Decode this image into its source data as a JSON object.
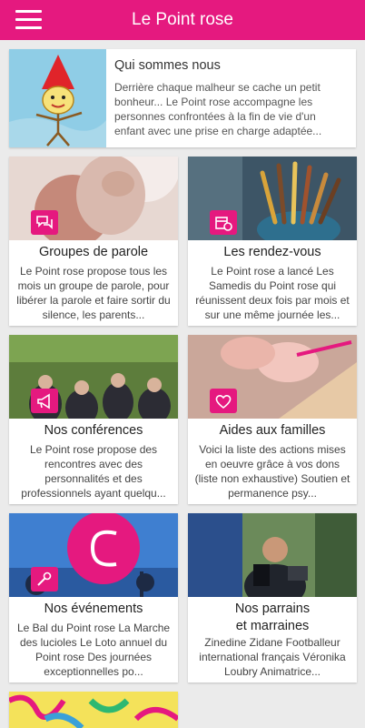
{
  "header": {
    "title": "Le Point rose",
    "menu_icon": "hamburger-menu-icon"
  },
  "hero": {
    "title": "Qui sommes nous",
    "text": "Derrière chaque malheur se cache un petit bonheur... Le Point rose accompagne les personnes confrontées à la fin de vie d'un enfant avec une prise en charge adaptée..."
  },
  "tiles": [
    {
      "title": "Groupes de parole",
      "text": "Le Point rose propose tous les mois un groupe de parole, pour libérer la parole et faire sortir du silence, les parents...",
      "icon": "speech-bubbles-icon"
    },
    {
      "title": "Les rendez-vous",
      "text": "Le Point rose a lancé Les Samedis du Point rose qui réunissent deux fois par mois et sur une même journée les...",
      "icon": "calendar-clock-icon"
    },
    {
      "title": "Nos conférences",
      "text": "Le Point rose propose des rencontres avec des personnalités et des professionnels ayant quelqu...",
      "icon": "megaphone-icon"
    },
    {
      "title": "Aides aux familles",
      "text": "Voici la liste des actions mises en oeuvre grâce à vos dons (liste non exhaustive) Soutien et permanence psy...",
      "icon": "handshake-heart-icon"
    },
    {
      "title": "Nos événements",
      "text": "Le Bal du Point rose  La Marche des lucioles  Le Loto annuel du Point rose  Des journées exceptionnelles po...",
      "icon": "microphone-icon"
    },
    {
      "title": "Nos parrains\net marraines",
      "text": "Zinedine Zidane Footballeur international français Véronika Loubry Animatrice...",
      "icon": "none"
    }
  ],
  "colors": {
    "brand_pink": "#e5197f",
    "background": "#ebebeb"
  }
}
